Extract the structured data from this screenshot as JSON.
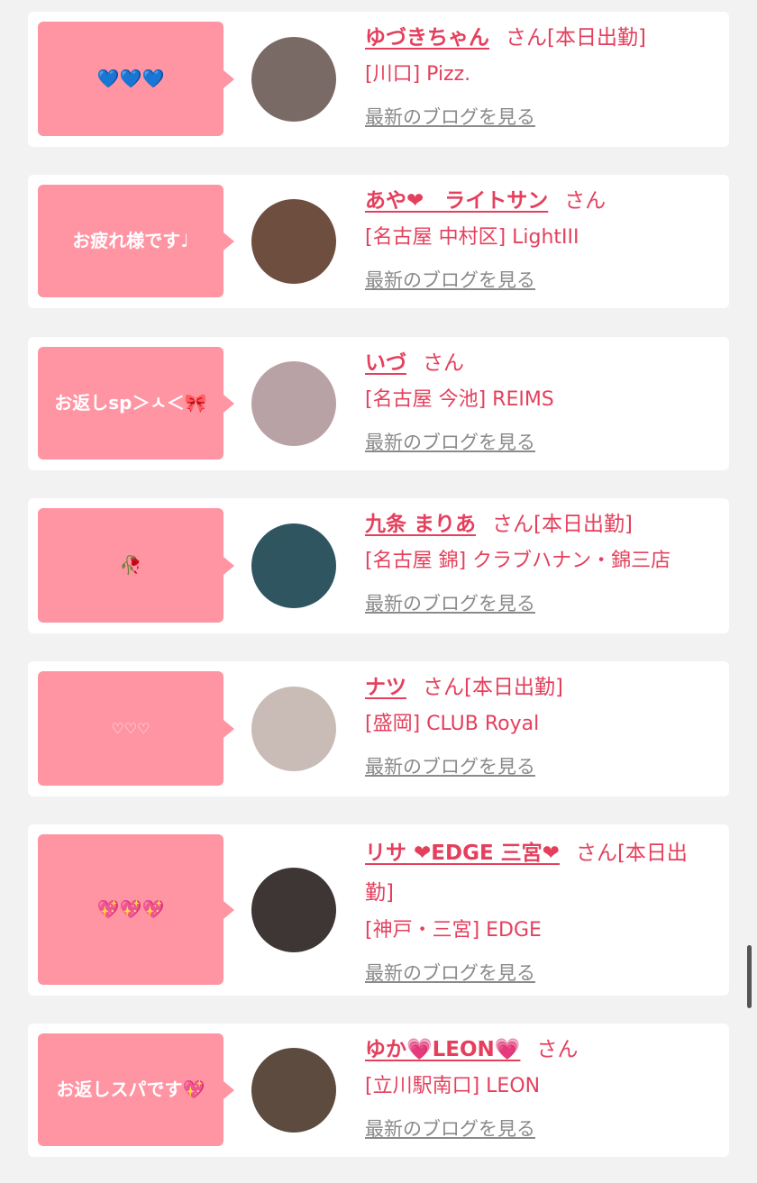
{
  "cards": [
    {
      "bubble": "💙💙💙",
      "name": "ゆづきちゃん",
      "suffix": "さん[本日出勤]",
      "shop": "[川口] Pizz.",
      "blog": "最新のブログを見る",
      "avatar_color": "#7a6a66"
    },
    {
      "bubble": "お疲れ様です♩",
      "name": "あや❤︎　ライトサン",
      "suffix": "さん",
      "shop": "[名古屋 中村区] LightIII",
      "blog": "最新のブログを見る",
      "avatar_color": "#6e4e3f"
    },
    {
      "bubble": "お返しsp＞ㅅ＜🎀",
      "name": "いづ",
      "suffix": "さん",
      "shop": "[名古屋 今池] REIMS",
      "blog": "最新のブログを見る",
      "avatar_color": "#b9a2a5"
    },
    {
      "bubble": "🥀",
      "name": "九条 まりあ",
      "suffix": "さん[本日出勤]",
      "shop": "[名古屋 錦] クラブハナン・錦三店",
      "blog": "最新のブログを見る",
      "avatar_color": "#2f5660"
    },
    {
      "bubble": "♡♡♡",
      "name": "ナツ",
      "suffix": "さん[本日出勤]",
      "shop": "[盛岡] CLUB Royal",
      "blog": "最新のブログを見る",
      "avatar_color": "#c9bbb5"
    },
    {
      "bubble": "💖💖💖",
      "name": "リサ ❤︎EDGE 三宮❤︎",
      "suffix": "さん[本日出勤]",
      "shop": "[神戸・三宮] EDGE",
      "blog": "最新のブログを見る",
      "avatar_color": "#3e3634"
    },
    {
      "bubble": "お返しスパです💖",
      "name": "ゆか💗LEON💗",
      "suffix": "さん",
      "shop": "[立川駅南口] LEON",
      "blog": "最新のブログを見る",
      "avatar_color": "#5c4b3e"
    }
  ]
}
